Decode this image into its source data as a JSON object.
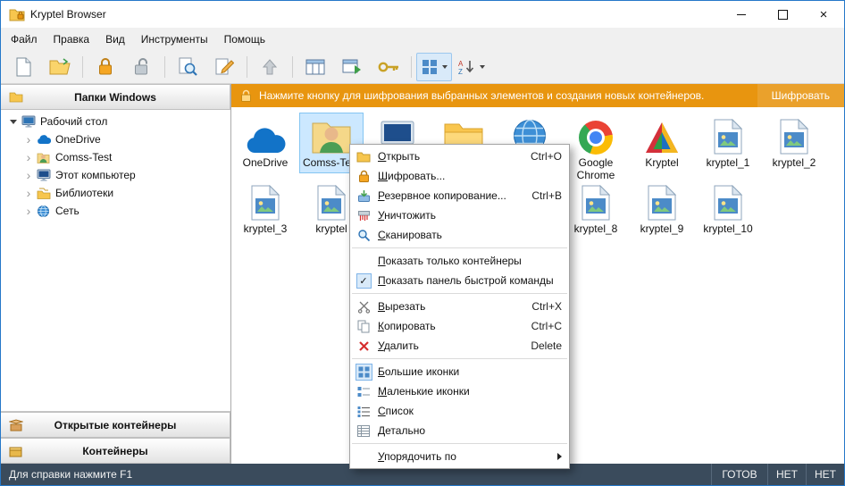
{
  "window": {
    "title": "Kryptel Browser"
  },
  "menubar": {
    "items": [
      {
        "label": "Файл"
      },
      {
        "label": "Правка"
      },
      {
        "label": "Вид"
      },
      {
        "label": "Инструменты"
      },
      {
        "label": "Помощь"
      }
    ]
  },
  "toolbar": {
    "icons": [
      "new-container",
      "open-folder",
      "encrypt-lock",
      "decrypt-lock",
      "search-document",
      "edit-document",
      "up-level",
      "view-panels",
      "quick-command-panel",
      "keys",
      "icon-view",
      "sort-order"
    ]
  },
  "sidebar": {
    "folders_panel_title": "Папки Windows",
    "tree": [
      {
        "label": "Рабочий стол",
        "expanded": true
      },
      {
        "label": "OneDrive"
      },
      {
        "label": "Comss-Test"
      },
      {
        "label": "Этот компьютер"
      },
      {
        "label": "Библиотеки"
      },
      {
        "label": "Сеть"
      }
    ],
    "open_containers_title": "Открытые контейнеры",
    "containers_title": "Контейнеры"
  },
  "banner": {
    "message": "Нажмите кнопку для шифрования выбранных элементов и создания новых контейнеров.",
    "encrypt_button": "Шифровать"
  },
  "files": {
    "items": [
      {
        "label": "OneDrive",
        "icon": "onedrive-cloud"
      },
      {
        "label": "Comss-Te...",
        "icon": "user-folder",
        "selected": true
      },
      {
        "label": "",
        "icon": "computer"
      },
      {
        "label": "",
        "icon": "folder"
      },
      {
        "label": "",
        "icon": "network-globe"
      },
      {
        "label": "Google Chrome",
        "icon": "google-chrome"
      },
      {
        "label": "Kryptel",
        "icon": "kryptel-logo"
      },
      {
        "label": "kryptel_1",
        "icon": "image-file"
      },
      {
        "label": "kryptel_2",
        "icon": "image-file"
      },
      {
        "label": "kryptel_3",
        "icon": "image-file"
      },
      {
        "label": "kryptel",
        "icon": "image-file"
      },
      {
        "label": "kryptel_8",
        "icon": "image-file"
      },
      {
        "label": "kryptel_9",
        "icon": "image-file"
      },
      {
        "label": "kryptel_10",
        "icon": "image-file"
      }
    ]
  },
  "context_menu": {
    "items": [
      {
        "label": "Открыть",
        "shortcut": "Ctrl+O"
      },
      {
        "label": "Шифровать..."
      },
      {
        "label": "Резервное копирование...",
        "shortcut": "Ctrl+B"
      },
      {
        "label": "Уничтожить"
      },
      {
        "label": "Сканировать"
      },
      {
        "label": "Показать только контейнеры"
      },
      {
        "label": "Показать панель быстрой команды",
        "checked": true
      },
      {
        "label": "Вырезать",
        "shortcut": "Ctrl+X"
      },
      {
        "label": "Копировать",
        "shortcut": "Ctrl+C"
      },
      {
        "label": "Удалить",
        "shortcut": "Delete"
      },
      {
        "label": "Большие иконки"
      },
      {
        "label": "Маленькие иконки"
      },
      {
        "label": "Список"
      },
      {
        "label": "Детально"
      },
      {
        "label": "Упорядочить по",
        "submenu": true
      }
    ]
  },
  "statusbar": {
    "help_text": "Для справки нажмите F1",
    "ready": "ГОТОВ",
    "field_1": "НЕТ",
    "field_2": "НЕТ"
  },
  "colors": {
    "banner_orange": "#E8950F",
    "selection_blue": "#CCE8FF",
    "statusbar_dark": "#3A4B5C",
    "window_border_blue": "#2578C9"
  }
}
